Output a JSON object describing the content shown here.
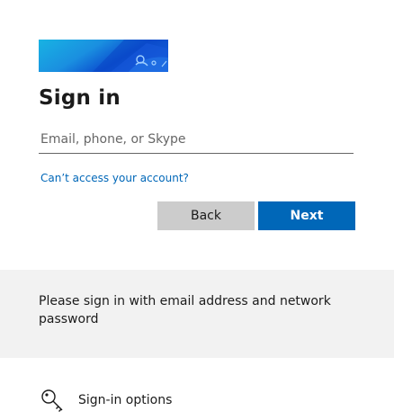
{
  "banner": {
    "icon": "brand-banner-graphic",
    "colors": [
      "#1ea0e0",
      "#0a52c6",
      "#2c7be5"
    ]
  },
  "form": {
    "title": "Sign in",
    "email_placeholder": "Email, phone, or Skype",
    "email_value": "",
    "access_link": "Can’t access your account?"
  },
  "buttons": {
    "back_label": "Back",
    "next_label": "Next"
  },
  "info": {
    "message": "Please sign in with email address and network password"
  },
  "options": {
    "icon": "key-icon",
    "label": "Sign-in options"
  },
  "colors": {
    "accent": "#0067b8",
    "back_button": "#cccccc",
    "info_background": "#f2f2f2",
    "text": "#1b1b1b"
  }
}
